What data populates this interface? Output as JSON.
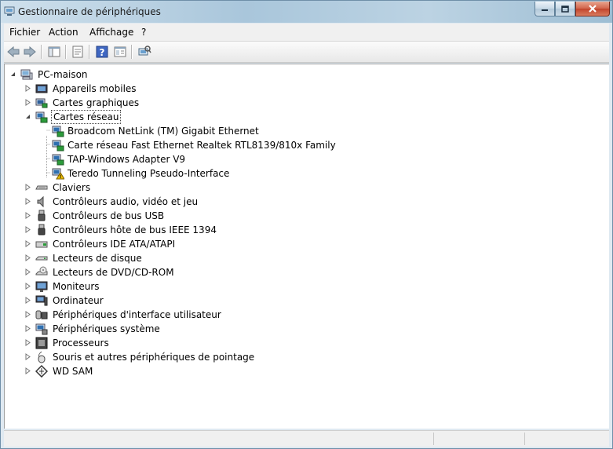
{
  "window": {
    "title": "Gestionnaire de périphériques"
  },
  "menu": [
    "Fichier",
    "Action",
    "Affichage",
    "?"
  ],
  "toolbar": {
    "buttons": [
      "back-icon",
      "forward-icon",
      "show-hide-tree-icon",
      "properties-icon",
      "help-icon",
      "console-view-icon",
      "scan-hardware-icon"
    ]
  },
  "tree": {
    "root": "PC-maison",
    "categories": [
      {
        "label": "Appareils mobiles",
        "icon": "mobile-device-icon"
      },
      {
        "label": "Cartes graphiques",
        "icon": "display-adapter-icon"
      },
      {
        "label": "Cartes réseau",
        "icon": "network-adapter-icon",
        "expanded": true,
        "selected": true,
        "children": [
          {
            "label": "Broadcom NetLink (TM) Gigabit Ethernet",
            "warning": false
          },
          {
            "label": "Carte réseau Fast Ethernet Realtek RTL8139/810x Family",
            "warning": false
          },
          {
            "label": "TAP-Windows Adapter V9",
            "warning": false
          },
          {
            "label": "Teredo Tunneling Pseudo-Interface",
            "warning": true
          }
        ]
      },
      {
        "label": "Claviers",
        "icon": "keyboard-icon"
      },
      {
        "label": "Contrôleurs audio, vidéo et jeu",
        "icon": "speaker-icon"
      },
      {
        "label": "Contrôleurs de bus USB",
        "icon": "usb-icon"
      },
      {
        "label": "Contrôleurs hôte de bus IEEE 1394",
        "icon": "firewire-icon"
      },
      {
        "label": "Contrôleurs IDE ATA/ATAPI",
        "icon": "ide-controller-icon"
      },
      {
        "label": "Lecteurs de disque",
        "icon": "disk-drive-icon"
      },
      {
        "label": "Lecteurs de DVD/CD-ROM",
        "icon": "dvd-drive-icon"
      },
      {
        "label": "Moniteurs",
        "icon": "monitor-icon"
      },
      {
        "label": "Ordinateur",
        "icon": "computer-icon"
      },
      {
        "label": "Périphériques d'interface utilisateur",
        "icon": "hid-icon"
      },
      {
        "label": "Périphériques système",
        "icon": "system-device-icon"
      },
      {
        "label": "Processeurs",
        "icon": "processor-icon"
      },
      {
        "label": "Souris et autres périphériques de pointage",
        "icon": "mouse-icon"
      },
      {
        "label": "WD SAM",
        "icon": "wd-sam-icon"
      }
    ]
  },
  "colors": {
    "selection_border": "#444444",
    "warning": "#f2c200",
    "titlebar": "#b5cddd"
  }
}
